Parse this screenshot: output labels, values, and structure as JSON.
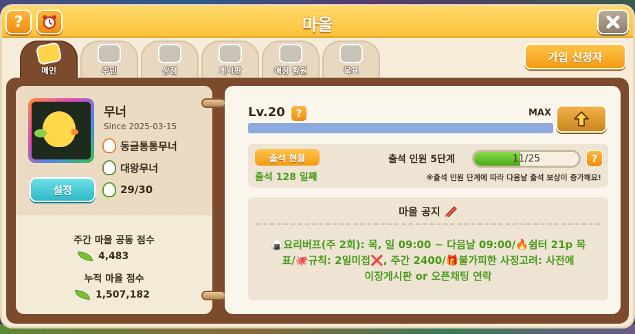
{
  "header": {
    "title": "마을",
    "help_label": "?"
  },
  "tabs": [
    {
      "label": "메인",
      "icon": "house-icon",
      "active": true
    },
    {
      "label": "주민",
      "icon": "resident-icon",
      "active": false
    },
    {
      "label": "상점",
      "icon": "shop-icon",
      "active": false
    },
    {
      "label": "게시판",
      "icon": "board-icon",
      "active": false
    },
    {
      "label": "애정 환원",
      "icon": "heart-icon",
      "active": false
    },
    {
      "label": "목표",
      "icon": "star-icon",
      "active": false
    }
  ],
  "applicant_button": "가입 신청자",
  "profile": {
    "nickname": "무너",
    "since": "Since 2025-03-15",
    "roles": [
      "동글통통무너",
      "대왕무너",
      "29/30"
    ],
    "settings_label": "설정"
  },
  "scores": {
    "weekly_title": "주간 마을 공동 점수",
    "weekly_value": "4,483",
    "total_title": "누적 마을 점수",
    "total_value": "1,507,182"
  },
  "level": {
    "label": "Lv.20",
    "max_label": "MAX",
    "help_label": "?",
    "progress": 1.0
  },
  "attendance": {
    "button_label": "출석 현황",
    "days_text": "출석 128 일째",
    "stage_label": "출석 인원 5단계",
    "count_text": "11/25",
    "current": 11,
    "total": 25,
    "help_label": "?",
    "note": "※출석 인원 단계에 따라 다음날 출석 보상이 증가해요!"
  },
  "notice": {
    "title": "마을 공지",
    "lines": [
      "🍙요리버프(주 2회): 목, 일 09:00 ~ 다음날 09:00/🔥쉼터 21p 목",
      "표/🐙규칙: 2일미접❌, 주간 2400/🎁불가피한 사정고려: 사전에",
      "이장게시판 or 오픈채팅 연락"
    ]
  },
  "colors": {
    "header": "#ffc23a",
    "board": "#7c4a2c",
    "accent_green": "#4a9a1a",
    "xp_bar": "#8da9de"
  }
}
